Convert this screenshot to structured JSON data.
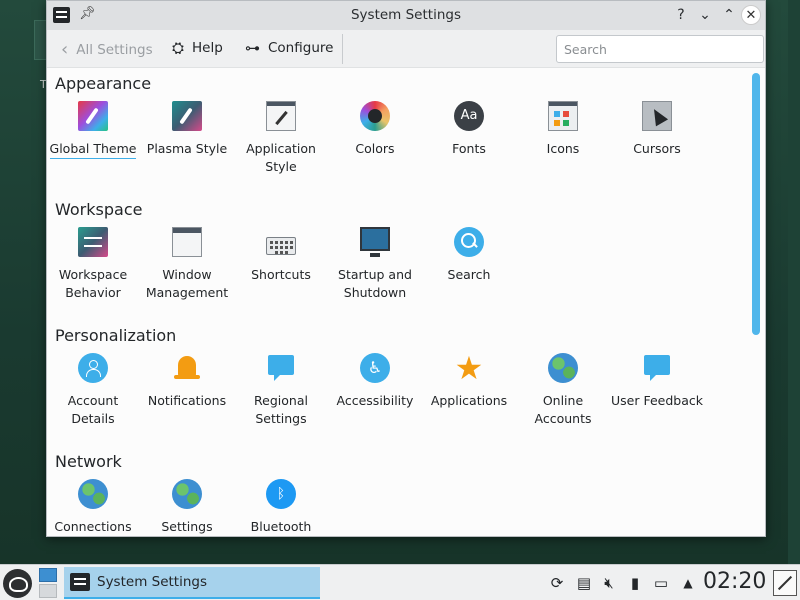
{
  "window": {
    "title": "System Settings"
  },
  "toolbar": {
    "back_label": "All Settings",
    "help_label": "Help",
    "configure_label": "Configure",
    "search_placeholder": "Search",
    "search_value": ""
  },
  "sections": {
    "appearance": {
      "title": "Appearance",
      "items": [
        {
          "label": "Global Theme",
          "icon": "global-theme-icon",
          "selected": true
        },
        {
          "label": "Plasma Style",
          "icon": "plasma-style-icon"
        },
        {
          "label": "Application Style",
          "icon": "application-style-icon"
        },
        {
          "label": "Colors",
          "icon": "colors-icon"
        },
        {
          "label": "Fonts",
          "icon": "fonts-icon",
          "glyph": "Aa"
        },
        {
          "label": "Icons",
          "icon": "icons-icon"
        },
        {
          "label": "Cursors",
          "icon": "cursors-icon"
        }
      ]
    },
    "workspace": {
      "title": "Workspace",
      "items": [
        {
          "label": "Workspace Behavior",
          "icon": "workspace-behavior-icon"
        },
        {
          "label": "Window Management",
          "icon": "window-management-icon"
        },
        {
          "label": "Shortcuts",
          "icon": "keyboard-icon"
        },
        {
          "label": "Startup and Shutdown",
          "icon": "monitor-icon"
        },
        {
          "label": "Search",
          "icon": "search-icon"
        }
      ]
    },
    "personalization": {
      "title": "Personalization",
      "items": [
        {
          "label": "Account Details",
          "icon": "account-icon"
        },
        {
          "label": "Notifications",
          "icon": "bell-icon"
        },
        {
          "label": "Regional Settings",
          "icon": "regional-settings-icon"
        },
        {
          "label": "Accessibility",
          "icon": "accessibility-icon"
        },
        {
          "label": "Applications",
          "icon": "star-icon"
        },
        {
          "label": "Online Accounts",
          "icon": "globe-icon"
        },
        {
          "label": "User Feedback",
          "icon": "feedback-icon"
        }
      ]
    },
    "network": {
      "title": "Network",
      "items": [
        {
          "label": "Connections",
          "icon": "globe-icon"
        },
        {
          "label": "Settings",
          "icon": "globe-icon"
        },
        {
          "label": "Bluetooth",
          "icon": "bluetooth-icon"
        }
      ]
    }
  },
  "taskbar": {
    "task_label": "System Settings",
    "clock": "02:20",
    "desktop_letter": "T"
  },
  "colors": {
    "accent": "#3daee9",
    "selection_bg": "#a6d2ec"
  }
}
